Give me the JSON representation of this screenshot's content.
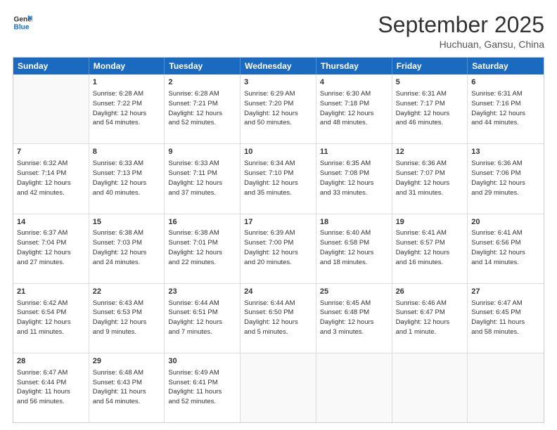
{
  "header": {
    "logo_line1": "General",
    "logo_line2": "Blue",
    "title": "September 2025",
    "subtitle": "Huchuan, Gansu, China"
  },
  "days": [
    "Sunday",
    "Monday",
    "Tuesday",
    "Wednesday",
    "Thursday",
    "Friday",
    "Saturday"
  ],
  "weeks": [
    [
      {
        "day": "",
        "data": ""
      },
      {
        "day": "1",
        "data": "Sunrise: 6:28 AM\nSunset: 7:22 PM\nDaylight: 12 hours\nand 54 minutes."
      },
      {
        "day": "2",
        "data": "Sunrise: 6:28 AM\nSunset: 7:21 PM\nDaylight: 12 hours\nand 52 minutes."
      },
      {
        "day": "3",
        "data": "Sunrise: 6:29 AM\nSunset: 7:20 PM\nDaylight: 12 hours\nand 50 minutes."
      },
      {
        "day": "4",
        "data": "Sunrise: 6:30 AM\nSunset: 7:18 PM\nDaylight: 12 hours\nand 48 minutes."
      },
      {
        "day": "5",
        "data": "Sunrise: 6:31 AM\nSunset: 7:17 PM\nDaylight: 12 hours\nand 46 minutes."
      },
      {
        "day": "6",
        "data": "Sunrise: 6:31 AM\nSunset: 7:16 PM\nDaylight: 12 hours\nand 44 minutes."
      }
    ],
    [
      {
        "day": "7",
        "data": "Sunrise: 6:32 AM\nSunset: 7:14 PM\nDaylight: 12 hours\nand 42 minutes."
      },
      {
        "day": "8",
        "data": "Sunrise: 6:33 AM\nSunset: 7:13 PM\nDaylight: 12 hours\nand 40 minutes."
      },
      {
        "day": "9",
        "data": "Sunrise: 6:33 AM\nSunset: 7:11 PM\nDaylight: 12 hours\nand 37 minutes."
      },
      {
        "day": "10",
        "data": "Sunrise: 6:34 AM\nSunset: 7:10 PM\nDaylight: 12 hours\nand 35 minutes."
      },
      {
        "day": "11",
        "data": "Sunrise: 6:35 AM\nSunset: 7:08 PM\nDaylight: 12 hours\nand 33 minutes."
      },
      {
        "day": "12",
        "data": "Sunrise: 6:36 AM\nSunset: 7:07 PM\nDaylight: 12 hours\nand 31 minutes."
      },
      {
        "day": "13",
        "data": "Sunrise: 6:36 AM\nSunset: 7:06 PM\nDaylight: 12 hours\nand 29 minutes."
      }
    ],
    [
      {
        "day": "14",
        "data": "Sunrise: 6:37 AM\nSunset: 7:04 PM\nDaylight: 12 hours\nand 27 minutes."
      },
      {
        "day": "15",
        "data": "Sunrise: 6:38 AM\nSunset: 7:03 PM\nDaylight: 12 hours\nand 24 minutes."
      },
      {
        "day": "16",
        "data": "Sunrise: 6:38 AM\nSunset: 7:01 PM\nDaylight: 12 hours\nand 22 minutes."
      },
      {
        "day": "17",
        "data": "Sunrise: 6:39 AM\nSunset: 7:00 PM\nDaylight: 12 hours\nand 20 minutes."
      },
      {
        "day": "18",
        "data": "Sunrise: 6:40 AM\nSunset: 6:58 PM\nDaylight: 12 hours\nand 18 minutes."
      },
      {
        "day": "19",
        "data": "Sunrise: 6:41 AM\nSunset: 6:57 PM\nDaylight: 12 hours\nand 16 minutes."
      },
      {
        "day": "20",
        "data": "Sunrise: 6:41 AM\nSunset: 6:56 PM\nDaylight: 12 hours\nand 14 minutes."
      }
    ],
    [
      {
        "day": "21",
        "data": "Sunrise: 6:42 AM\nSunset: 6:54 PM\nDaylight: 12 hours\nand 11 minutes."
      },
      {
        "day": "22",
        "data": "Sunrise: 6:43 AM\nSunset: 6:53 PM\nDaylight: 12 hours\nand 9 minutes."
      },
      {
        "day": "23",
        "data": "Sunrise: 6:44 AM\nSunset: 6:51 PM\nDaylight: 12 hours\nand 7 minutes."
      },
      {
        "day": "24",
        "data": "Sunrise: 6:44 AM\nSunset: 6:50 PM\nDaylight: 12 hours\nand 5 minutes."
      },
      {
        "day": "25",
        "data": "Sunrise: 6:45 AM\nSunset: 6:48 PM\nDaylight: 12 hours\nand 3 minutes."
      },
      {
        "day": "26",
        "data": "Sunrise: 6:46 AM\nSunset: 6:47 PM\nDaylight: 12 hours\nand 1 minute."
      },
      {
        "day": "27",
        "data": "Sunrise: 6:47 AM\nSunset: 6:45 PM\nDaylight: 11 hours\nand 58 minutes."
      }
    ],
    [
      {
        "day": "28",
        "data": "Sunrise: 6:47 AM\nSunset: 6:44 PM\nDaylight: 11 hours\nand 56 minutes."
      },
      {
        "day": "29",
        "data": "Sunrise: 6:48 AM\nSunset: 6:43 PM\nDaylight: 11 hours\nand 54 minutes."
      },
      {
        "day": "30",
        "data": "Sunrise: 6:49 AM\nSunset: 6:41 PM\nDaylight: 11 hours\nand 52 minutes."
      },
      {
        "day": "",
        "data": ""
      },
      {
        "day": "",
        "data": ""
      },
      {
        "day": "",
        "data": ""
      },
      {
        "day": "",
        "data": ""
      }
    ]
  ]
}
